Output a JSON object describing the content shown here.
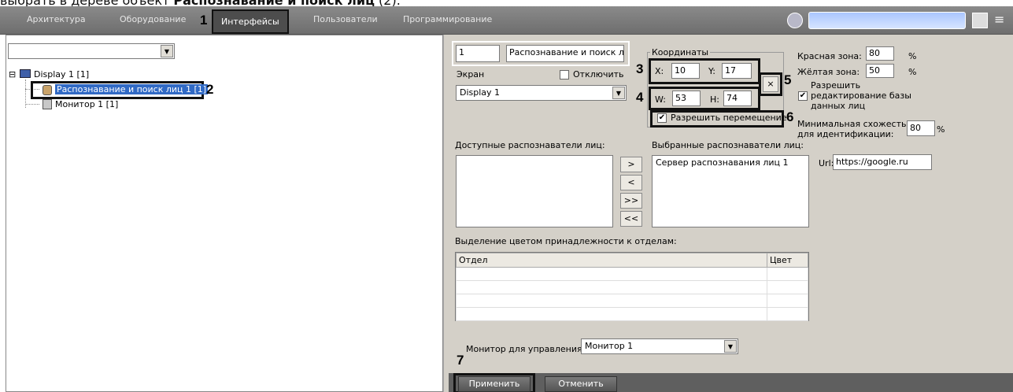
{
  "caption": {
    "prefix": "выбрать в дереве объект ",
    "bold": "Распознавание и поиск лиц",
    "suffix": " (2)."
  },
  "menu": {
    "items": [
      "Архитектура",
      "Оборудование",
      "Интерфейсы",
      "Пользователи",
      "Программирование"
    ],
    "active_index": 2
  },
  "callouts": [
    "1",
    "2",
    "3",
    "4",
    "5",
    "6",
    "7"
  ],
  "tree": {
    "filter_value": "",
    "root": {
      "label": "Display 1 [1]",
      "expander": "⊟"
    },
    "children": [
      {
        "label": "Распознавание и поиск лиц 1 [1]",
        "selected": true
      },
      {
        "label": "Монитор 1 [1]",
        "selected": false
      }
    ]
  },
  "settings": {
    "id_value": "1",
    "name_value": "Распознавание и поиск лиц",
    "screen_label": "Экран",
    "disable_label": "Отключить",
    "disable_checked": false,
    "screen_value": "Display 1",
    "coords": {
      "title": "Координаты",
      "x_label": "X:",
      "x_value": "10",
      "y_label": "Y:",
      "y_value": "17",
      "w_label": "W:",
      "w_value": "53",
      "h_label": "H:",
      "h_value": "74",
      "close_glyph": "×",
      "allow_move_label": "Разрешить перемещение",
      "allow_move_checked": true
    },
    "red_zone_label": "Красная зона:",
    "red_zone_value": "80",
    "yellow_zone_label": "Жёлтая зона:",
    "yellow_zone_value": "50",
    "percent": "%",
    "allow_edit_label_1": "Разрешить",
    "allow_edit_label_2": "редактирование базы",
    "allow_edit_label_3": "данных лиц",
    "allow_edit_checked": true,
    "min_sim_label_1": "Минимальная схожесть",
    "min_sim_label_2": "для идентификации:",
    "min_sim_value": "80",
    "available_label": "Доступные распознаватели лиц:",
    "selected_label": "Выбранные распознаватели лиц:",
    "selected_items": [
      "Сервер распознавания лиц 1"
    ],
    "move_buttons": [
      ">",
      "<",
      ">>",
      "<<"
    ],
    "url_label": "Url:",
    "url_value": "https://google.ru",
    "dept_label": "Выделение цветом принадлежности к отделам:",
    "dept_columns": [
      "Отдел",
      "Цвет"
    ],
    "monitor_label": "Монитор для управления:",
    "monitor_value": "Монитор 1",
    "apply_label": "Применить",
    "cancel_label": "Отменить"
  },
  "colors": {
    "menubar": "#7a7a7a",
    "selected": "#316ac5",
    "panel": "#d4d0c8"
  }
}
